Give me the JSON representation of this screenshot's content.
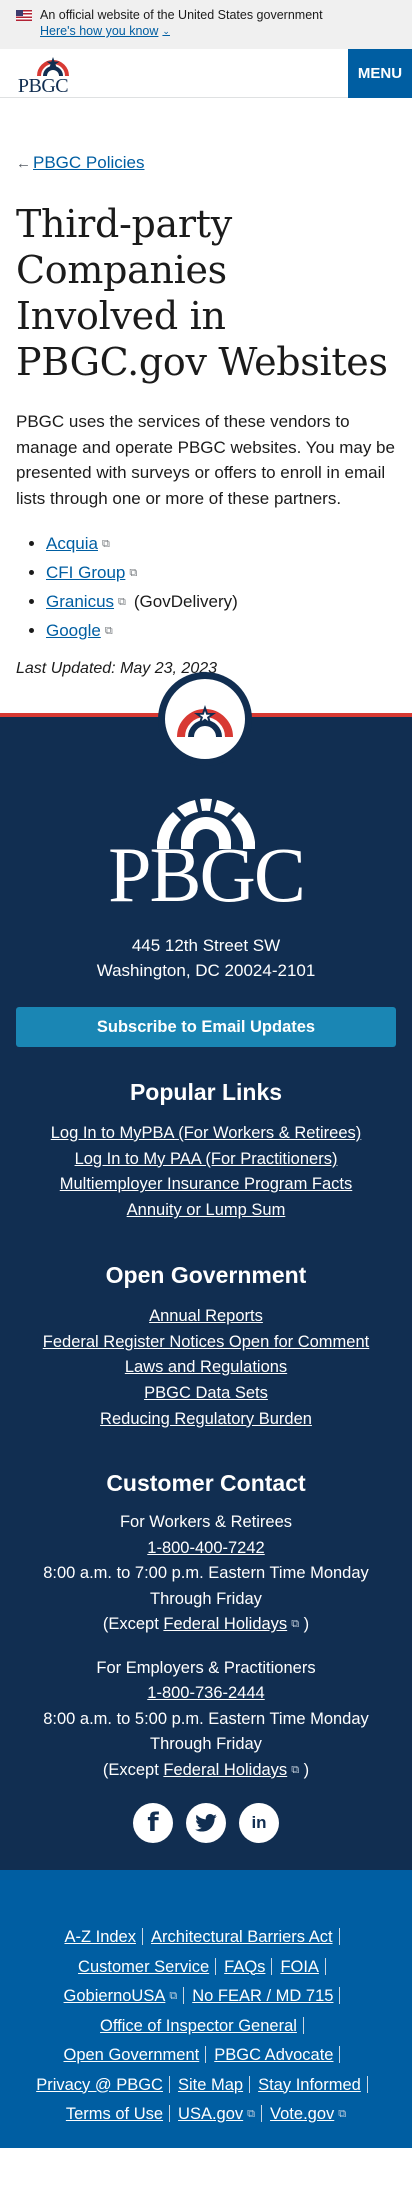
{
  "gov_banner": {
    "official_text": "An official website of the United States government",
    "how_know": "Here's how you know"
  },
  "header": {
    "logo_text": "PBGC",
    "menu_label": "MENU"
  },
  "main": {
    "back_link": "PBGC Policies",
    "title": "Third-party Companies Involved in PBGC.gov Websites",
    "intro": "PBGC uses the services of these vendors to manage and operate PBGC websites. You may be presented with surveys or offers to enroll in email lists through one or more of these partners.",
    "vendors": [
      {
        "label": "Acquia",
        "note": ""
      },
      {
        "label": "CFI Group",
        "note": ""
      },
      {
        "label": "Granicus",
        "note": "(GovDelivery)"
      },
      {
        "label": "Google",
        "note": ""
      }
    ],
    "last_updated": "Last Updated: May 23, 2023"
  },
  "footer": {
    "logo_text": "PBGC",
    "address_line1": "445 12th Street SW",
    "address_line2": "Washington, DC 20024-2101",
    "subscribe_label": "Subscribe to Email Updates",
    "popular_links_heading": "Popular Links",
    "popular_links": [
      "Log In to MyPBA (For Workers & Retirees)",
      "Log In to My PAA (For Practitioners)",
      "Multiemployer Insurance Program Facts",
      "Annuity or Lump Sum"
    ],
    "open_gov_heading": "Open Government",
    "open_gov_links": [
      "Annual Reports",
      "Federal Register Notices Open for Comment",
      "Laws and Regulations",
      "PBGC Data Sets",
      "Reducing Regulatory Burden"
    ],
    "contact_heading": "Customer Contact",
    "contacts": [
      {
        "audience": "For Workers & Retirees",
        "phone": "1-800-400-7242",
        "hours": "8:00 a.m. to 7:00 p.m. Eastern Time Monday Through Friday",
        "except_prefix": "(Except",
        "holiday_link": "Federal Holidays",
        "except_suffix": ")"
      },
      {
        "audience": "For Employers & Practitioners",
        "phone": "1-800-736-2444",
        "hours": "8:00 a.m. to 5:00 p.m. Eastern Time Monday Through Friday",
        "except_prefix": "(Except",
        "holiday_link": "Federal Holidays",
        "except_suffix": ")"
      }
    ],
    "social": {
      "facebook": "f",
      "twitter": "🐦",
      "linkedin": "in"
    },
    "bottom_links": [
      [
        "A-Z Index",
        "Architectural Barriers Act"
      ],
      [
        "Customer Service",
        "FAQs",
        "FOIA"
      ],
      [
        "GobiernoUSA",
        "No FEAR / MD 715"
      ],
      [
        "Office of Inspector General"
      ],
      [
        "Open Government",
        "PBGC Advocate"
      ],
      [
        "Privacy @ PBGC",
        "Site Map",
        "Stay Informed"
      ],
      [
        "Terms of Use",
        "USA.gov",
        "Vote.gov"
      ]
    ]
  }
}
